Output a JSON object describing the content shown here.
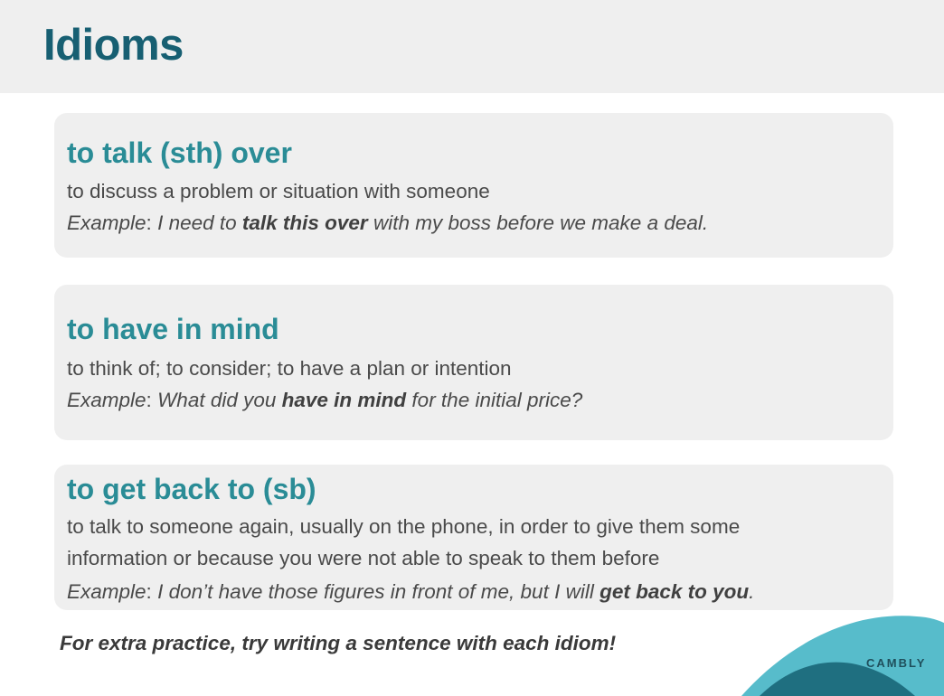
{
  "page": {
    "title": "Idioms"
  },
  "idioms": [
    {
      "term": "to talk (sth) over",
      "definition_lines": [
        "to discuss a problem or situation with someone"
      ],
      "example": {
        "label": "Example",
        "before": "I need to ",
        "emphasis": "talk this over",
        "after": " with my boss before we make a deal."
      }
    },
    {
      "term": "to have in mind",
      "definition_lines": [
        "to think of; to consider; to have a plan or intention"
      ],
      "example": {
        "label": "Example",
        "before": "What did you ",
        "emphasis": "have in mind",
        "after": " for the initial price?"
      }
    },
    {
      "term": "to get back to (sb)",
      "definition_lines": [
        "to talk to someone again, usually on the phone, in order to give them some",
        "information or because you were not able to speak to them before"
      ],
      "example": {
        "label": "Example",
        "before": "I don’t have those figures in front of me, but I will ",
        "emphasis": "get back to you",
        "after": "."
      }
    }
  ],
  "footer": {
    "practice_note": "For extra practice, try writing a sentence with each idiom!",
    "brand": "CAMBLY"
  },
  "colors": {
    "title": "#175f72",
    "term": "#2a8c96",
    "card_bg": "#efefef",
    "brand_light": "#57bccb",
    "brand_dark": "#1f6f80"
  }
}
